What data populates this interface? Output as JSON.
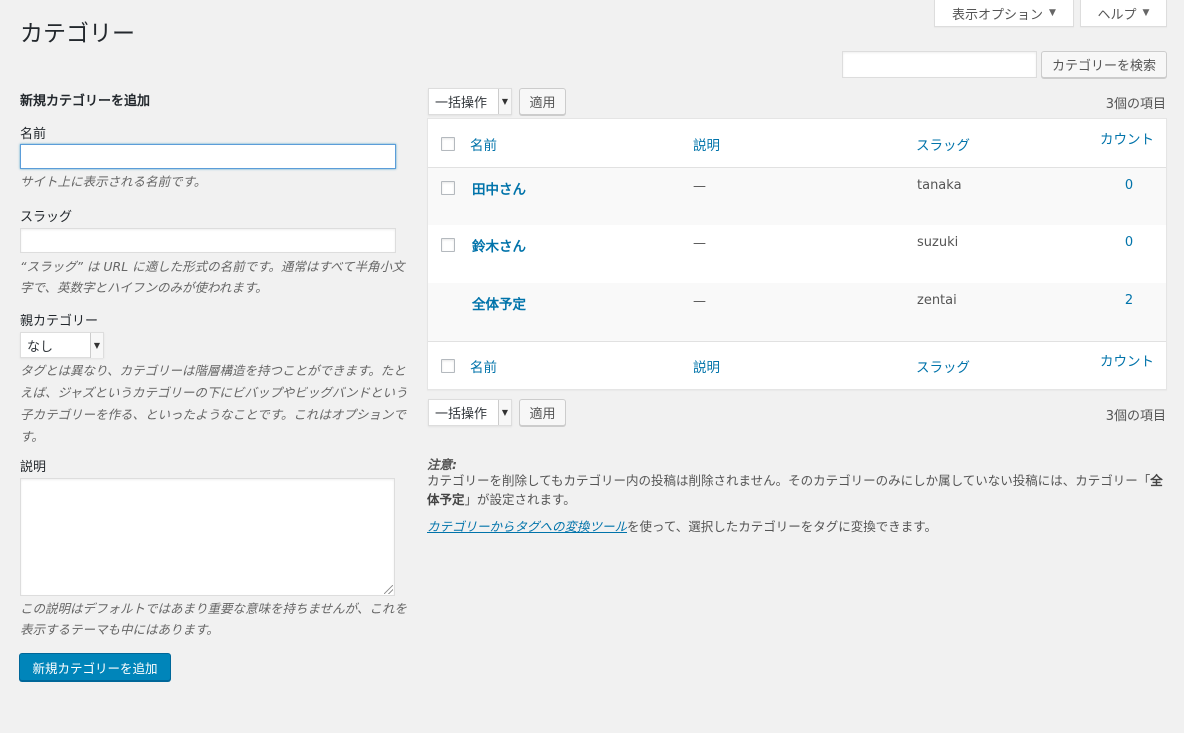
{
  "screen_options": {
    "label": "表示オプション",
    "arrow": "▼"
  },
  "help": {
    "label": "ヘルプ",
    "arrow": "▼"
  },
  "page_title": "カテゴリー",
  "search": {
    "value": "",
    "placeholder": "",
    "button_label": "カテゴリーを検索"
  },
  "form": {
    "heading": "新規カテゴリーを追加",
    "name_label": "名前",
    "name_value": "",
    "name_desc": "サイト上に表示される名前です。",
    "slug_label": "スラッグ",
    "slug_value": "",
    "slug_desc": "“スラッグ” は URL に適した形式の名前です。通常はすべて半角小文字で、英数字とハイフンのみが使われます。",
    "parent_label": "親カテゴリー",
    "parent_selected": "なし",
    "parent_desc": "タグとは異なり、カテゴリーは階層構造を持つことができます。たとえば、ジャズというカテゴリーの下にビバップやビッグバンドという子カテゴリーを作る、といったようなことです。これはオプションです。",
    "desc_label": "説明",
    "desc_value": "",
    "desc_help": "この説明はデフォルトではあまり重要な意味を持ちませんが、これを表示するテーマも中にはあります。",
    "submit_label": "新規カテゴリーを追加"
  },
  "bulk": {
    "selected": "一括操作",
    "apply_label": "適用"
  },
  "items_count": "3個の項目",
  "table": {
    "columns": {
      "name": "名前",
      "description": "説明",
      "slug": "スラッグ",
      "count": "カウント"
    },
    "rows": [
      {
        "name": "田中さん",
        "description": "—",
        "slug": "tanaka",
        "count": "0"
      },
      {
        "name": "鈴木さん",
        "description": "—",
        "slug": "suzuki",
        "count": "0"
      },
      {
        "name": "全体予定",
        "description": "—",
        "slug": "zentai",
        "count": "2"
      }
    ]
  },
  "note": {
    "title": "注意:",
    "text_before": "カテゴリーを削除してもカテゴリー内の投稿は削除されません。そのカテゴリーのみにしか属していない投稿には、カテゴリー「",
    "default_category": "全体予定",
    "text_after": "」が設定されます。",
    "converter_link": "カテゴリーからタグへの変換ツール",
    "converter_text": "を使って、選択したカテゴリーをタグに変換できます。"
  }
}
